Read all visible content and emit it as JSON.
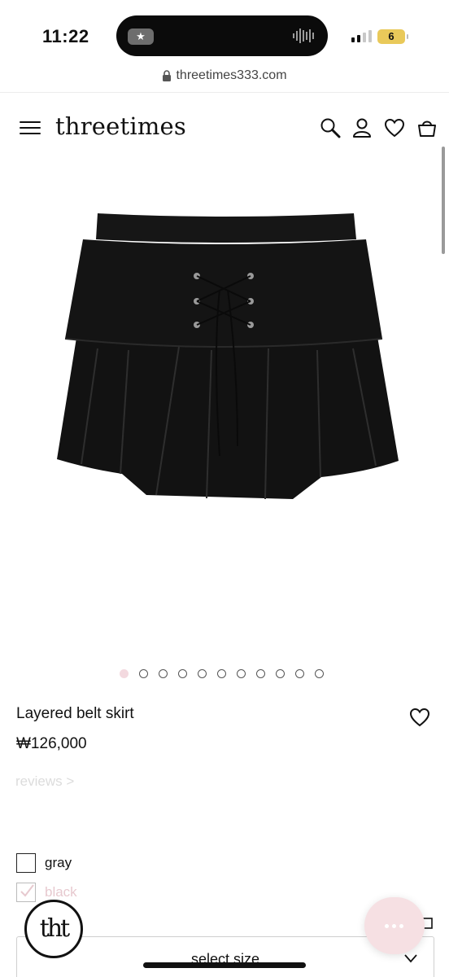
{
  "status_bar": {
    "time": "11:22",
    "battery": "6",
    "island_app_glyph": "★"
  },
  "browser": {
    "url": "threetimes333.com"
  },
  "header": {
    "logo": "threetimes",
    "icons": [
      "menu-icon",
      "search-icon",
      "user-icon",
      "heart-icon",
      "bag-icon"
    ]
  },
  "gallery": {
    "total_images": 11,
    "active_index": 0
  },
  "product": {
    "name": "Layered belt skirt",
    "price": "₩126,000",
    "reviews_link": "reviews >"
  },
  "options": [
    {
      "label": "gray",
      "checked": false
    },
    {
      "label": "black",
      "checked": true
    }
  ],
  "size_select": {
    "placeholder": "select size"
  },
  "floating": {
    "brand_badge": "tht",
    "chat_icon": "chat-bubble-icon"
  },
  "colors": {
    "accent_pink": "#f3d9df",
    "dim_text": "#dcdcdc",
    "battery": "#e9c95a"
  }
}
